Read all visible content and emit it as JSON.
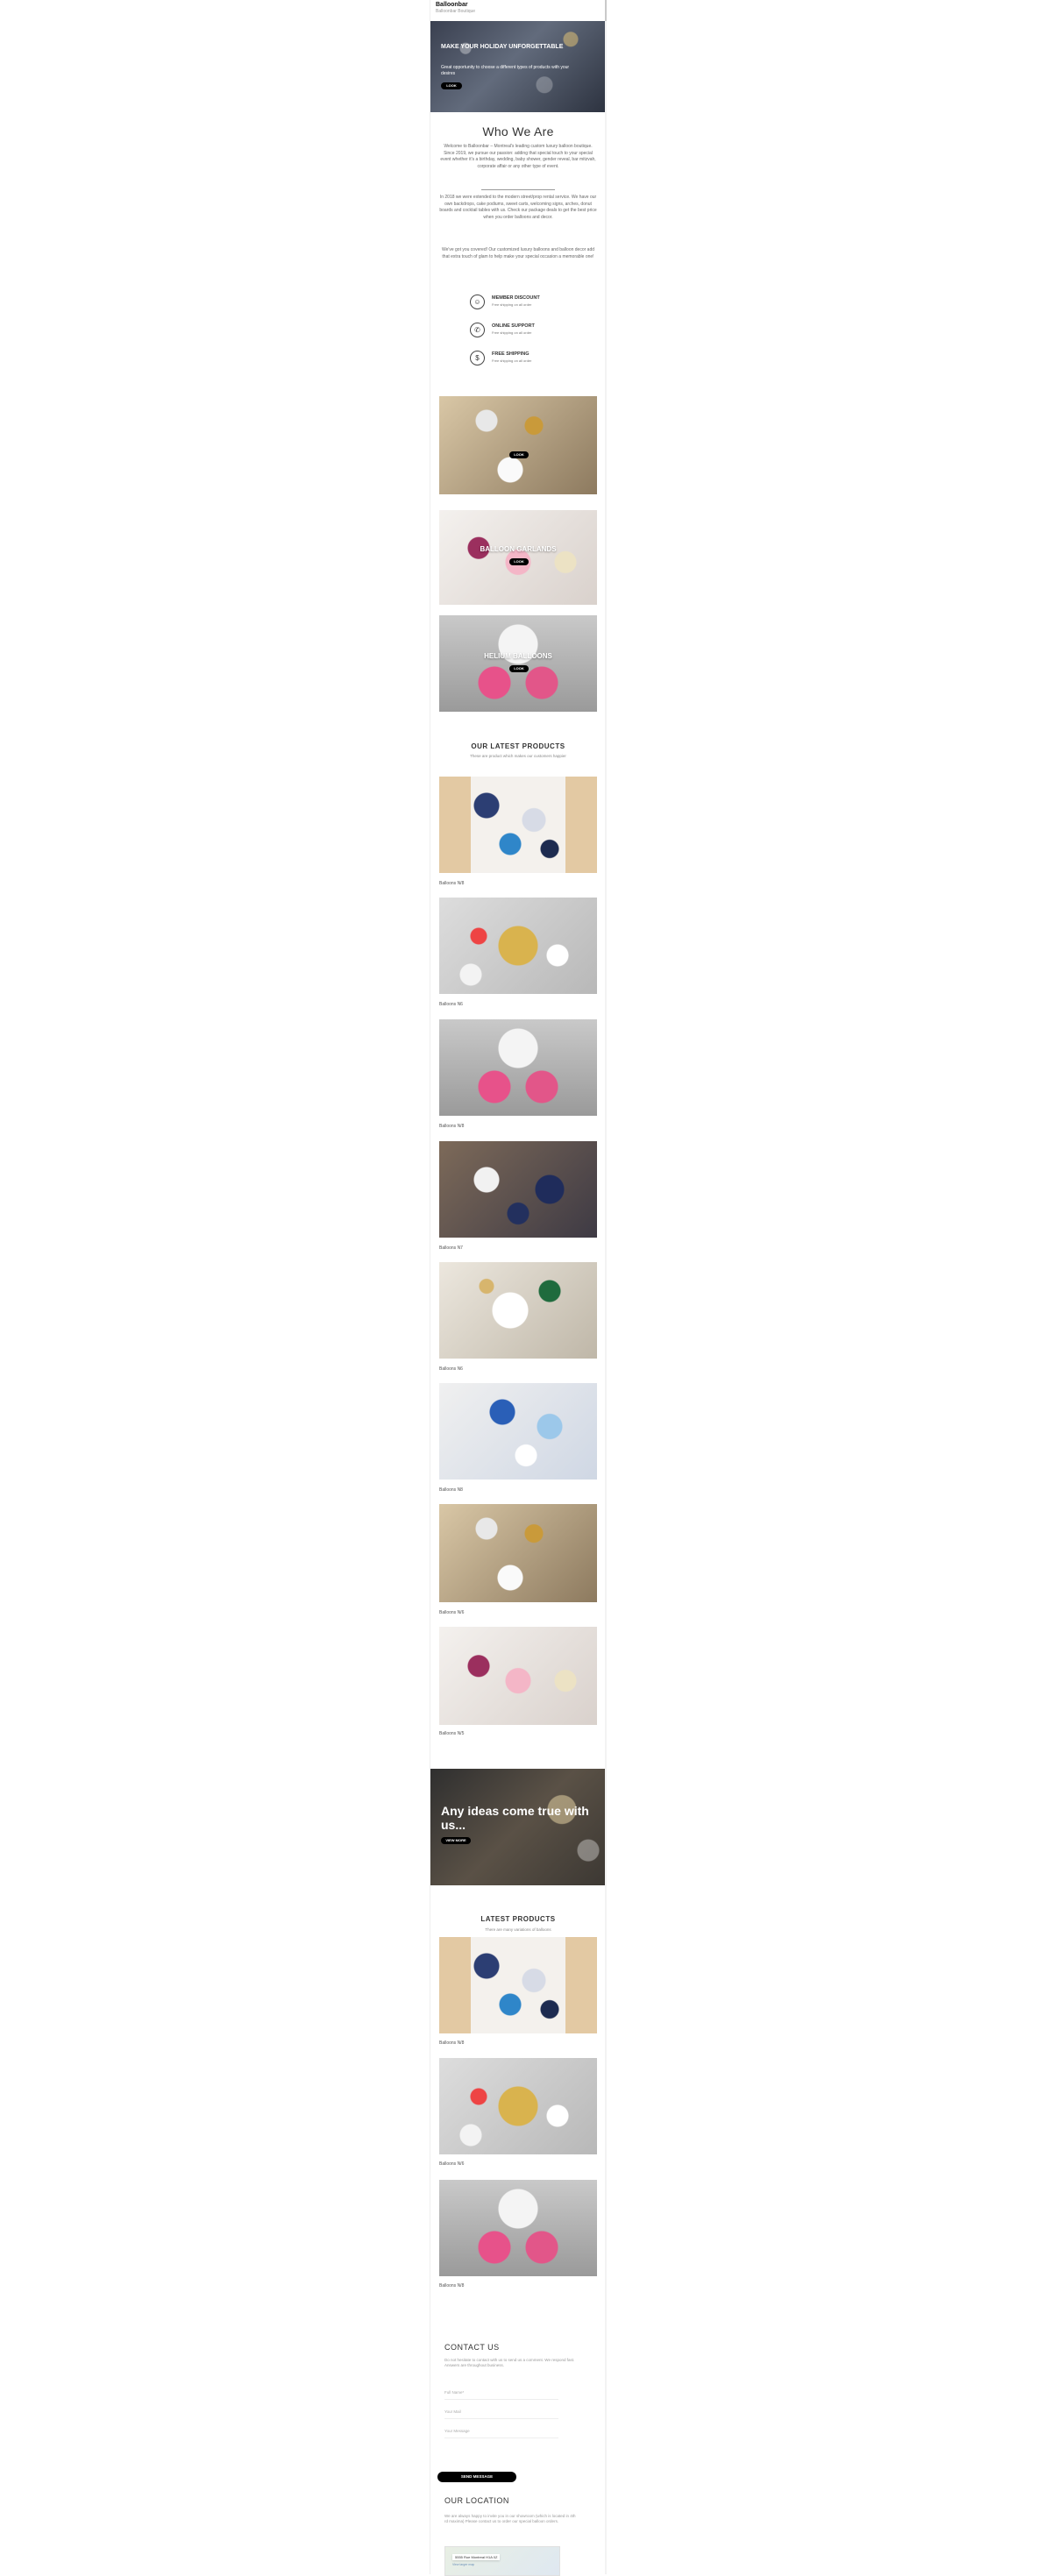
{
  "header": {
    "brand": "Balloonbar",
    "tagline": "Balloonbar Boutique"
  },
  "hero": {
    "title": "MAKE YOUR HOLIDAY UNFORGETTABLE",
    "subtitle": "Great opportunity to choose a different types of products with your desires",
    "button": "LOOK"
  },
  "about": {
    "title": "Who We Are",
    "paragraphs": [
      "Welcome to Balloonbar – Montreal's leading custom luxury balloon boutique. Since 2019, we pursue our passion: adding that special touch to your special event whether it's a birthday, wedding, baby shower, gender reveal, bar mitzvah, corporate affair or any other type of event.",
      "In 2018 we were extended to the modern street/prop rental service. We have our own backdrops, cake podiums, sweet carts, welcoming signs, arches, donut boards and cocktail tables with us. Check our package deals to get the best price when you order balloons and decor.",
      "We've got you covered! Our customized luxury balloons and balloon decor add that extra touch of glam to help make your special occasion a memorable one!"
    ]
  },
  "features": [
    {
      "icon": "member-icon",
      "glyph": "☺",
      "title": "MEMBER DISCOUNT",
      "subtitle": "Free shipping on all order"
    },
    {
      "icon": "support-icon",
      "glyph": "✆",
      "title": "ONLINE SUPPORT",
      "subtitle": "Free shipping on all order"
    },
    {
      "icon": "shipping-icon",
      "glyph": "$",
      "title": "FREE SHIPPING",
      "subtitle": "Free shipping on all order"
    }
  ],
  "categories": [
    {
      "label": "",
      "button": "LOOK"
    },
    {
      "label": "BALLOON GARLANDS",
      "button": "LOOK"
    },
    {
      "label": "HELIUM BALLOONS",
      "button": "LOOK"
    }
  ],
  "our_products": {
    "title": "OUR LATEST PRODUCTS",
    "subtitle": "These are product which makes our customers happier",
    "items": [
      {
        "name": "Balloons N/8"
      },
      {
        "name": "Balloons N6"
      },
      {
        "name": "Balloons N/8"
      },
      {
        "name": "Balloons N7"
      },
      {
        "name": "Balloons N6"
      },
      {
        "name": "Balloons N8"
      },
      {
        "name": "Balloons N/6"
      },
      {
        "name": "Balloons N/5"
      }
    ]
  },
  "promo": {
    "title": "Any ideas come true with us...",
    "button": "VIEW MORE"
  },
  "latest_products": {
    "title": "LATEST PRODUCTS",
    "subtitle": "There are many variations of balloons",
    "items": [
      {
        "name": "Balloons N/8"
      },
      {
        "name": "Balloons N/6"
      },
      {
        "name": "Balloons N/8"
      }
    ]
  },
  "contact": {
    "title": "CONTACT US",
    "text": "Do not hesitate to contact with us to send us a comment. We respond fast. Answers are throughout business.",
    "name_placeholder": "Full Name*",
    "email_placeholder": "Your Mail",
    "message_placeholder": "Your Message",
    "send": "SEND MESSAGE"
  },
  "location": {
    "title": "OUR LOCATION",
    "text": "We are always happy to invite you in our showroom (which is located in 4th rd maxima) Please contact us to order our special balloon orders.",
    "map_label": "5555 Rue Montreal H1A 0Z",
    "map_sub": "View larger map"
  },
  "colors": {
    "accent": "#000000",
    "text": "#333333",
    "muted": "#999999"
  }
}
